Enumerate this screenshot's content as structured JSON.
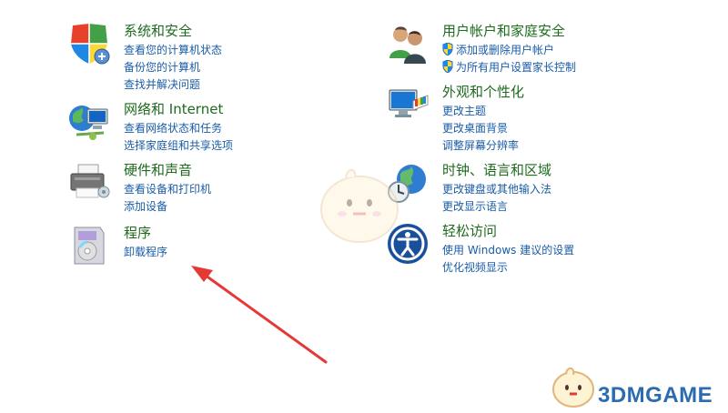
{
  "categories": [
    {
      "title": "系统和安全",
      "links": [
        "查看您的计算机状态",
        "备份您的计算机",
        "查找并解决问题"
      ],
      "icon": "security-shield-icon"
    },
    {
      "title": "网络和 Internet",
      "links": [
        "查看网络状态和任务",
        "选择家庭组和共享选项"
      ],
      "icon": "network-globe-icon"
    },
    {
      "title": "硬件和声音",
      "links": [
        "查看设备和打印机",
        "添加设备"
      ],
      "icon": "printer-icon"
    },
    {
      "title": "程序",
      "links": [
        "卸载程序"
      ],
      "icon": "programs-box-icon"
    },
    {
      "title": "用户帐户和家庭安全",
      "links": [
        "添加或删除用户帐户",
        "为所有用户设置家长控制"
      ],
      "icon": "users-icon"
    },
    {
      "title": "外观和个性化",
      "links": [
        "更改主题",
        "更改桌面背景",
        "调整屏幕分辨率"
      ],
      "icon": "monitor-palette-icon"
    },
    {
      "title": "时钟、语言和区域",
      "links": [
        "更改键盘或其他输入法",
        "更改显示语言"
      ],
      "icon": "clock-globe-icon"
    },
    {
      "title": "轻松访问",
      "links": [
        "使用 Windows 建议的设置",
        "优化视频显示"
      ],
      "icon": "ease-of-access-icon"
    }
  ],
  "watermark": "3DMGAME",
  "colors": {
    "title": "#1e6b1e",
    "link": "#1a5ca8",
    "arrow": "#e53935"
  }
}
